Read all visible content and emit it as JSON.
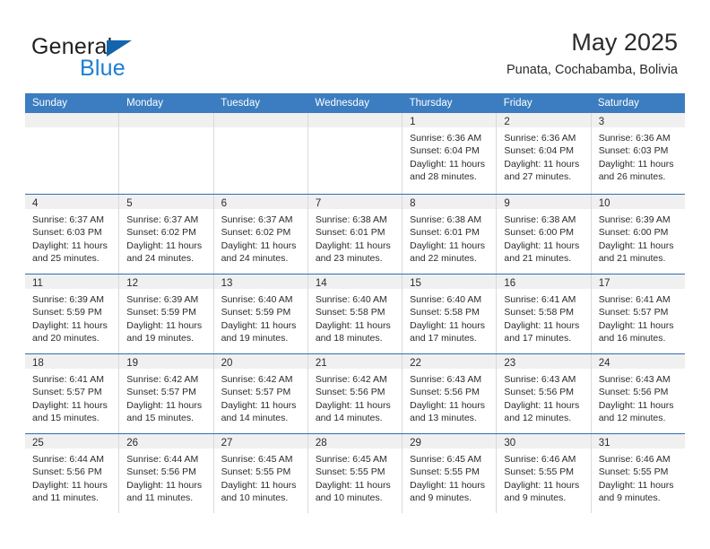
{
  "logo": {
    "word_top": "General",
    "word_bottom": "Blue",
    "triangle_color": "#1464ad",
    "blue_text_color": "#1a7fd4"
  },
  "header": {
    "title": "May 2025",
    "subtitle": "Punata, Cochabamba, Bolivia"
  },
  "theme": {
    "header_blue": "#3b7dc0",
    "row_rule_blue": "#2f6fb0",
    "day_band_gray": "#f0f0f0",
    "cell_border": "#d9d9d9"
  },
  "weekdays": [
    "Sunday",
    "Monday",
    "Tuesday",
    "Wednesday",
    "Thursday",
    "Friday",
    "Saturday"
  ],
  "weeks": [
    [
      {
        "empty": true
      },
      {
        "empty": true
      },
      {
        "empty": true
      },
      {
        "empty": true
      },
      {
        "day": "1",
        "sunrise": "Sunrise: 6:36 AM",
        "sunset": "Sunset: 6:04 PM",
        "daylight1": "Daylight: 11 hours",
        "daylight2": "and 28 minutes."
      },
      {
        "day": "2",
        "sunrise": "Sunrise: 6:36 AM",
        "sunset": "Sunset: 6:04 PM",
        "daylight1": "Daylight: 11 hours",
        "daylight2": "and 27 minutes."
      },
      {
        "day": "3",
        "sunrise": "Sunrise: 6:36 AM",
        "sunset": "Sunset: 6:03 PM",
        "daylight1": "Daylight: 11 hours",
        "daylight2": "and 26 minutes."
      }
    ],
    [
      {
        "day": "4",
        "sunrise": "Sunrise: 6:37 AM",
        "sunset": "Sunset: 6:03 PM",
        "daylight1": "Daylight: 11 hours",
        "daylight2": "and 25 minutes."
      },
      {
        "day": "5",
        "sunrise": "Sunrise: 6:37 AM",
        "sunset": "Sunset: 6:02 PM",
        "daylight1": "Daylight: 11 hours",
        "daylight2": "and 24 minutes."
      },
      {
        "day": "6",
        "sunrise": "Sunrise: 6:37 AM",
        "sunset": "Sunset: 6:02 PM",
        "daylight1": "Daylight: 11 hours",
        "daylight2": "and 24 minutes."
      },
      {
        "day": "7",
        "sunrise": "Sunrise: 6:38 AM",
        "sunset": "Sunset: 6:01 PM",
        "daylight1": "Daylight: 11 hours",
        "daylight2": "and 23 minutes."
      },
      {
        "day": "8",
        "sunrise": "Sunrise: 6:38 AM",
        "sunset": "Sunset: 6:01 PM",
        "daylight1": "Daylight: 11 hours",
        "daylight2": "and 22 minutes."
      },
      {
        "day": "9",
        "sunrise": "Sunrise: 6:38 AM",
        "sunset": "Sunset: 6:00 PM",
        "daylight1": "Daylight: 11 hours",
        "daylight2": "and 21 minutes."
      },
      {
        "day": "10",
        "sunrise": "Sunrise: 6:39 AM",
        "sunset": "Sunset: 6:00 PM",
        "daylight1": "Daylight: 11 hours",
        "daylight2": "and 21 minutes."
      }
    ],
    [
      {
        "day": "11",
        "sunrise": "Sunrise: 6:39 AM",
        "sunset": "Sunset: 5:59 PM",
        "daylight1": "Daylight: 11 hours",
        "daylight2": "and 20 minutes."
      },
      {
        "day": "12",
        "sunrise": "Sunrise: 6:39 AM",
        "sunset": "Sunset: 5:59 PM",
        "daylight1": "Daylight: 11 hours",
        "daylight2": "and 19 minutes."
      },
      {
        "day": "13",
        "sunrise": "Sunrise: 6:40 AM",
        "sunset": "Sunset: 5:59 PM",
        "daylight1": "Daylight: 11 hours",
        "daylight2": "and 19 minutes."
      },
      {
        "day": "14",
        "sunrise": "Sunrise: 6:40 AM",
        "sunset": "Sunset: 5:58 PM",
        "daylight1": "Daylight: 11 hours",
        "daylight2": "and 18 minutes."
      },
      {
        "day": "15",
        "sunrise": "Sunrise: 6:40 AM",
        "sunset": "Sunset: 5:58 PM",
        "daylight1": "Daylight: 11 hours",
        "daylight2": "and 17 minutes."
      },
      {
        "day": "16",
        "sunrise": "Sunrise: 6:41 AM",
        "sunset": "Sunset: 5:58 PM",
        "daylight1": "Daylight: 11 hours",
        "daylight2": "and 17 minutes."
      },
      {
        "day": "17",
        "sunrise": "Sunrise: 6:41 AM",
        "sunset": "Sunset: 5:57 PM",
        "daylight1": "Daylight: 11 hours",
        "daylight2": "and 16 minutes."
      }
    ],
    [
      {
        "day": "18",
        "sunrise": "Sunrise: 6:41 AM",
        "sunset": "Sunset: 5:57 PM",
        "daylight1": "Daylight: 11 hours",
        "daylight2": "and 15 minutes."
      },
      {
        "day": "19",
        "sunrise": "Sunrise: 6:42 AM",
        "sunset": "Sunset: 5:57 PM",
        "daylight1": "Daylight: 11 hours",
        "daylight2": "and 15 minutes."
      },
      {
        "day": "20",
        "sunrise": "Sunrise: 6:42 AM",
        "sunset": "Sunset: 5:57 PM",
        "daylight1": "Daylight: 11 hours",
        "daylight2": "and 14 minutes."
      },
      {
        "day": "21",
        "sunrise": "Sunrise: 6:42 AM",
        "sunset": "Sunset: 5:56 PM",
        "daylight1": "Daylight: 11 hours",
        "daylight2": "and 14 minutes."
      },
      {
        "day": "22",
        "sunrise": "Sunrise: 6:43 AM",
        "sunset": "Sunset: 5:56 PM",
        "daylight1": "Daylight: 11 hours",
        "daylight2": "and 13 minutes."
      },
      {
        "day": "23",
        "sunrise": "Sunrise: 6:43 AM",
        "sunset": "Sunset: 5:56 PM",
        "daylight1": "Daylight: 11 hours",
        "daylight2": "and 12 minutes."
      },
      {
        "day": "24",
        "sunrise": "Sunrise: 6:43 AM",
        "sunset": "Sunset: 5:56 PM",
        "daylight1": "Daylight: 11 hours",
        "daylight2": "and 12 minutes."
      }
    ],
    [
      {
        "day": "25",
        "sunrise": "Sunrise: 6:44 AM",
        "sunset": "Sunset: 5:56 PM",
        "daylight1": "Daylight: 11 hours",
        "daylight2": "and 11 minutes."
      },
      {
        "day": "26",
        "sunrise": "Sunrise: 6:44 AM",
        "sunset": "Sunset: 5:56 PM",
        "daylight1": "Daylight: 11 hours",
        "daylight2": "and 11 minutes."
      },
      {
        "day": "27",
        "sunrise": "Sunrise: 6:45 AM",
        "sunset": "Sunset: 5:55 PM",
        "daylight1": "Daylight: 11 hours",
        "daylight2": "and 10 minutes."
      },
      {
        "day": "28",
        "sunrise": "Sunrise: 6:45 AM",
        "sunset": "Sunset: 5:55 PM",
        "daylight1": "Daylight: 11 hours",
        "daylight2": "and 10 minutes."
      },
      {
        "day": "29",
        "sunrise": "Sunrise: 6:45 AM",
        "sunset": "Sunset: 5:55 PM",
        "daylight1": "Daylight: 11 hours",
        "daylight2": "and 9 minutes."
      },
      {
        "day": "30",
        "sunrise": "Sunrise: 6:46 AM",
        "sunset": "Sunset: 5:55 PM",
        "daylight1": "Daylight: 11 hours",
        "daylight2": "and 9 minutes."
      },
      {
        "day": "31",
        "sunrise": "Sunrise: 6:46 AM",
        "sunset": "Sunset: 5:55 PM",
        "daylight1": "Daylight: 11 hours",
        "daylight2": "and 9 minutes."
      }
    ]
  ]
}
